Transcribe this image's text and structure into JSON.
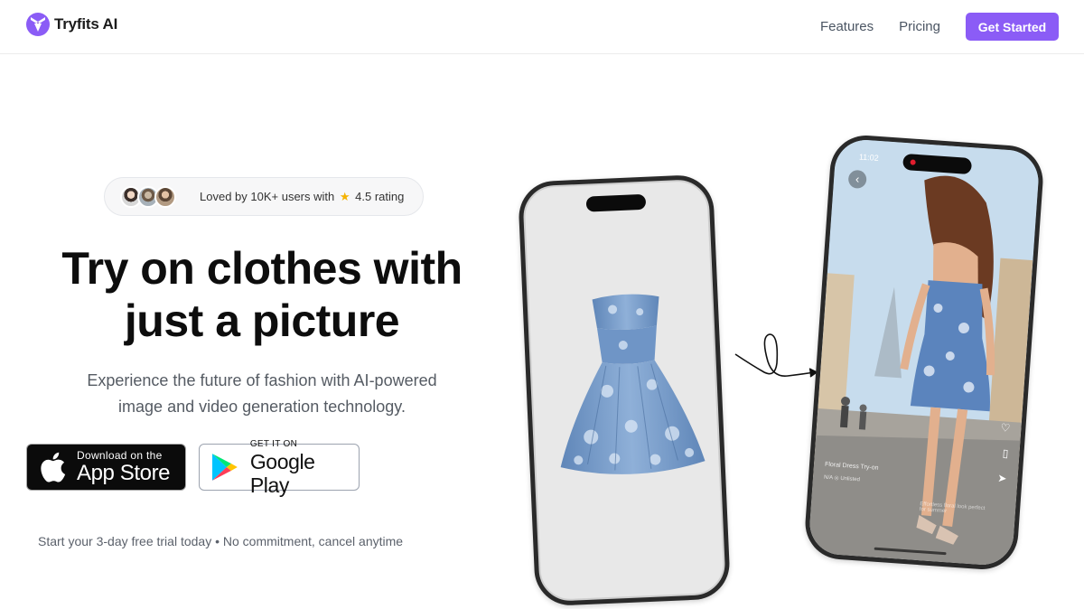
{
  "header": {
    "brand": "Tryfits AI",
    "nav": [
      {
        "label": "Features"
      },
      {
        "label": "Pricing"
      }
    ],
    "cta_label": "Get Started"
  },
  "hero": {
    "rating_text_pre": "Loved by 10K+ users with",
    "rating_text_post": "4.5 rating",
    "rating_icon": "star-icon",
    "headline_line1": "Try on clothes with",
    "headline_line2": "just a picture",
    "subtext_line1": "Experience the future of fashion with AI-powered",
    "subtext_line2": "image and video generation technology.",
    "app_store": {
      "small": "Download on the",
      "big": "App Store"
    },
    "google_play": {
      "small": "GET IT ON",
      "big": "Google Play"
    },
    "trial_note": "Start your 3-day free trial today • No commitment, cancel anytime"
  },
  "phone_right": {
    "status_time": "11:02",
    "caption": "Floral Dress Try-on",
    "sub": "N/A  ◎  Unlisted",
    "sub_right": "Effortless floral look perfect for summer"
  },
  "colors": {
    "accent": "#8b5cf6",
    "text_dark": "#0d0d0d",
    "text_muted": "#555b63"
  }
}
